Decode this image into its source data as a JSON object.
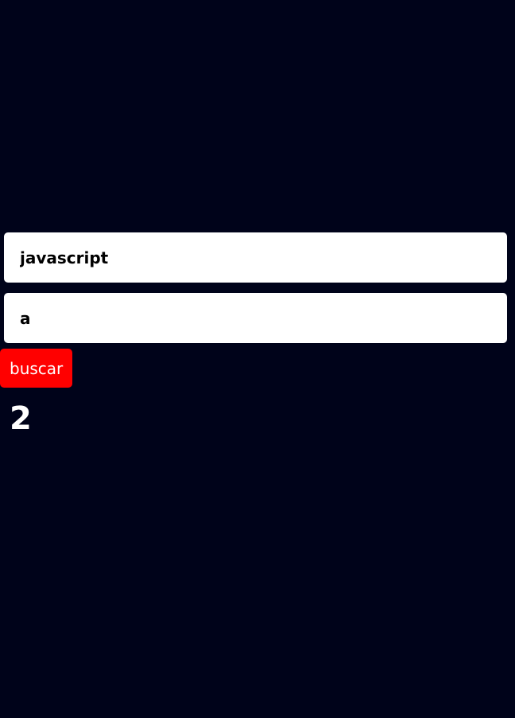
{
  "form": {
    "text_value": "javascript",
    "char_value": "a",
    "search_label": "buscar"
  },
  "result": {
    "count": "2"
  },
  "colors": {
    "background": "#00031a",
    "button": "#ff0000",
    "field": "#ffffff"
  }
}
